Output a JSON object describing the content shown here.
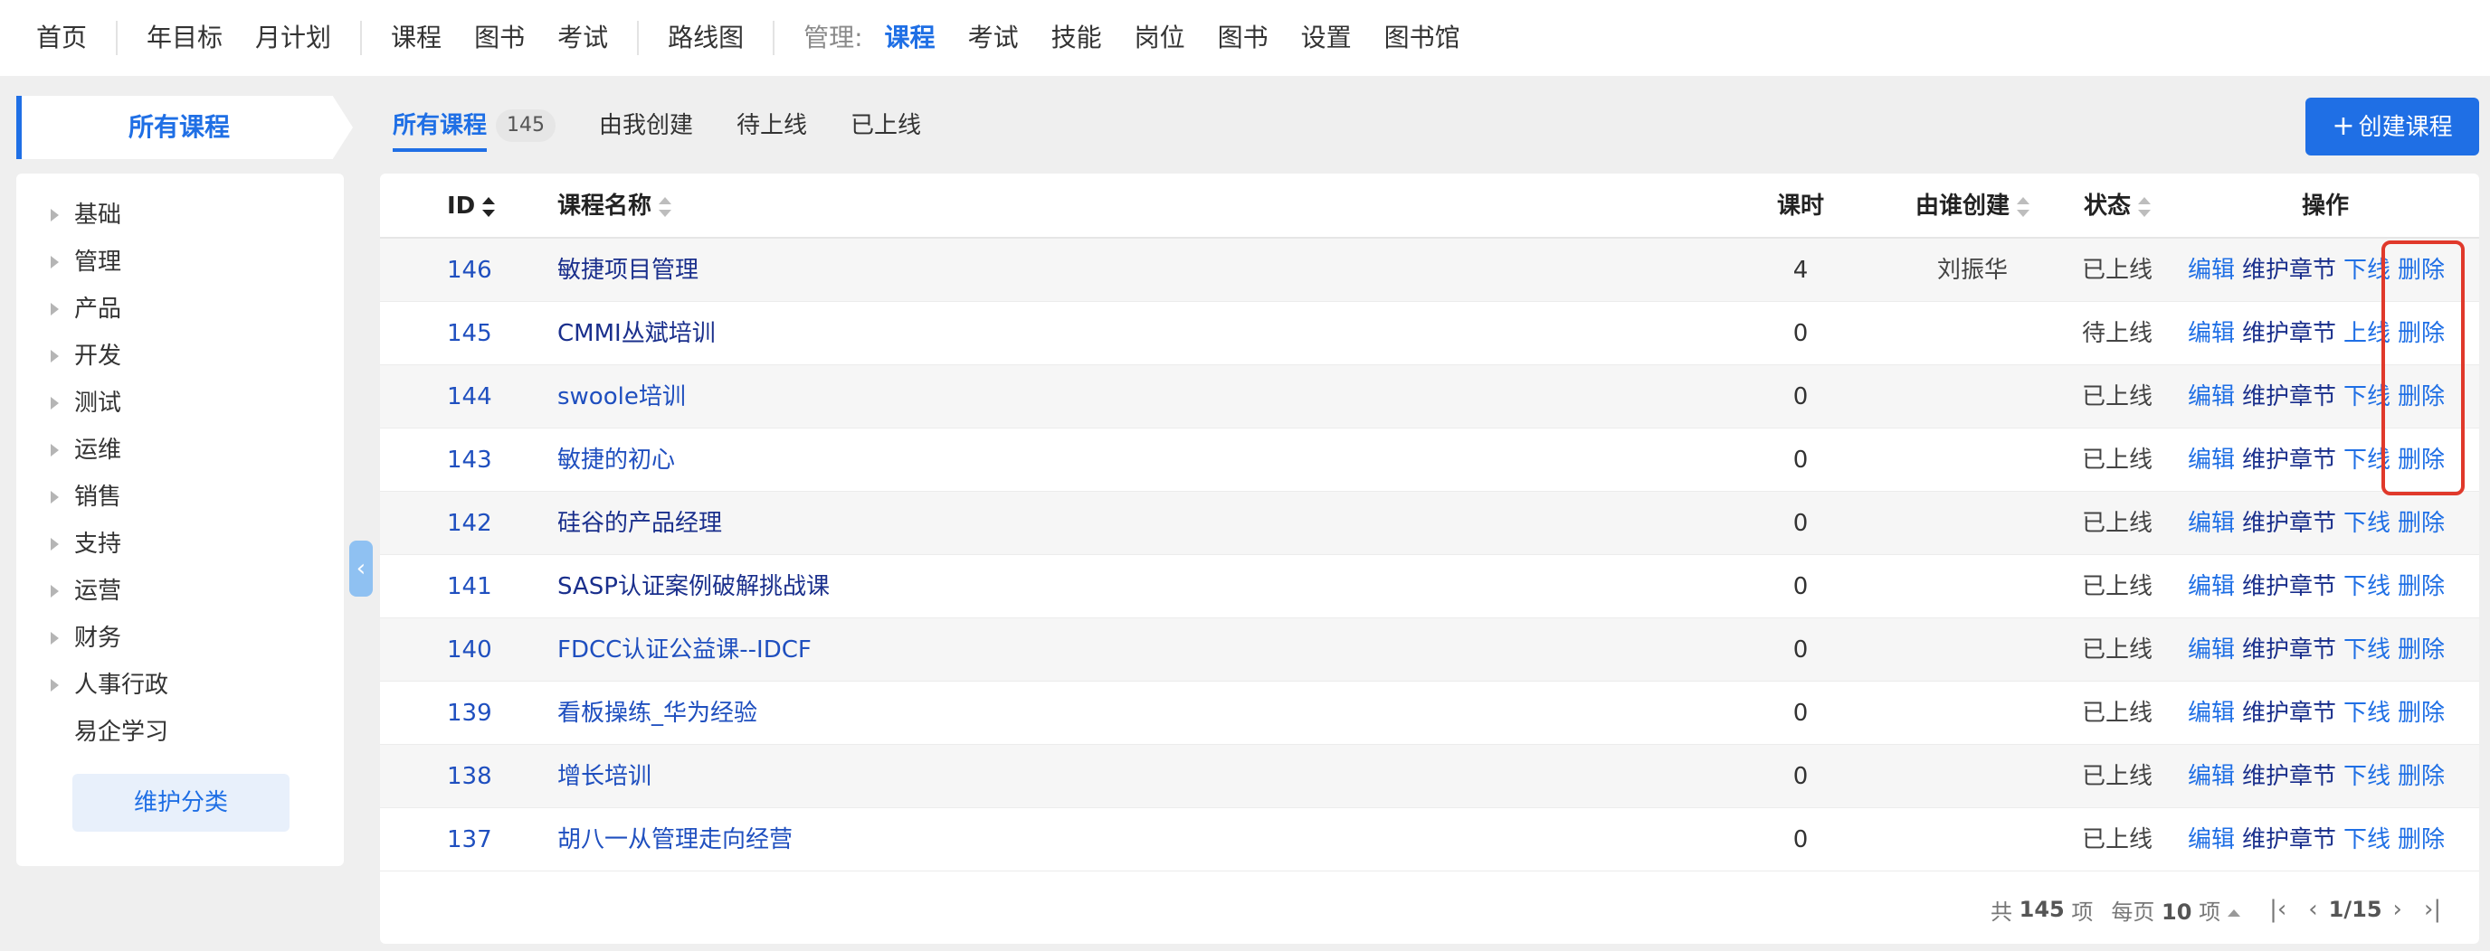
{
  "nav": {
    "home": "首页",
    "year_goal": "年目标",
    "month_plan": "月计划",
    "course": "课程",
    "books": "图书",
    "exam": "考试",
    "roadmap": "路线图",
    "manage_label": "管理:",
    "m_course": "课程",
    "m_exam": "考试",
    "m_skill": "技能",
    "m_position": "岗位",
    "m_books": "图书",
    "m_settings": "设置",
    "m_library": "图书馆"
  },
  "sidebar": {
    "title": "所有课程",
    "categories": [
      "基础",
      "管理",
      "产品",
      "开发",
      "测试",
      "运维",
      "销售",
      "支持",
      "运营",
      "财务",
      "人事行政"
    ],
    "extra": "易企学习",
    "maintain_button": "维护分类",
    "collapse_icon": "chevron-left-icon"
  },
  "tabs": {
    "all": "所有课程",
    "all_count": "145",
    "mine": "由我创建",
    "pending": "待上线",
    "online": "已上线"
  },
  "create_button": "创建课程",
  "table": {
    "headers": {
      "id": "ID",
      "name": "课程名称",
      "hours": "课时",
      "creator": "由谁创建",
      "status": "状态",
      "ops": "操作"
    },
    "rows": [
      {
        "id": "146",
        "name": "敏捷项目管理",
        "hours": "4",
        "creator": "刘振华",
        "status": "已上线",
        "edit": "编辑",
        "chapters": "维护章节",
        "toggle": "下线",
        "delete": "删除"
      },
      {
        "id": "145",
        "name": "CMMI丛斌培训",
        "hours": "0",
        "creator": "",
        "status": "待上线",
        "edit": "编辑",
        "chapters": "维护章节",
        "toggle": "上线",
        "delete": "删除"
      },
      {
        "id": "144",
        "name": "swoole培训",
        "hours": "0",
        "creator": "",
        "status": "已上线",
        "edit": "编辑",
        "chapters": "维护章节",
        "toggle": "下线",
        "delete": "删除"
      },
      {
        "id": "143",
        "name": "敏捷的初心",
        "hours": "0",
        "creator": "",
        "status": "已上线",
        "edit": "编辑",
        "chapters": "维护章节",
        "toggle": "下线",
        "delete": "删除"
      },
      {
        "id": "142",
        "name": "硅谷的产品经理",
        "hours": "0",
        "creator": "",
        "status": "已上线",
        "edit": "编辑",
        "chapters": "维护章节",
        "toggle": "下线",
        "delete": "删除"
      },
      {
        "id": "141",
        "name": "SASP认证案例破解挑战课",
        "hours": "0",
        "creator": "",
        "status": "已上线",
        "edit": "编辑",
        "chapters": "维护章节",
        "toggle": "下线",
        "delete": "删除"
      },
      {
        "id": "140",
        "name": "FDCC认证公益课--IDCF",
        "hours": "0",
        "creator": "",
        "status": "已上线",
        "edit": "编辑",
        "chapters": "维护章节",
        "toggle": "下线",
        "delete": "删除"
      },
      {
        "id": "139",
        "name": "看板操练_华为经验",
        "hours": "0",
        "creator": "",
        "status": "已上线",
        "edit": "编辑",
        "chapters": "维护章节",
        "toggle": "下线",
        "delete": "删除"
      },
      {
        "id": "138",
        "name": "增长培训",
        "hours": "0",
        "creator": "",
        "status": "已上线",
        "edit": "编辑",
        "chapters": "维护章节",
        "toggle": "下线",
        "delete": "删除"
      },
      {
        "id": "137",
        "name": "胡八一从管理走向经营",
        "hours": "0",
        "creator": "",
        "status": "已上线",
        "edit": "编辑",
        "chapters": "维护章节",
        "toggle": "下线",
        "delete": "删除"
      }
    ]
  },
  "pager": {
    "total_prefix": "共",
    "total": "145",
    "total_suffix": "项",
    "per_page_prefix": "每页",
    "per_page": "10",
    "per_page_suffix": "项",
    "page": "1/15"
  },
  "colors": {
    "accent": "#1f6fe5",
    "highlight_border": "#e0392b"
  }
}
